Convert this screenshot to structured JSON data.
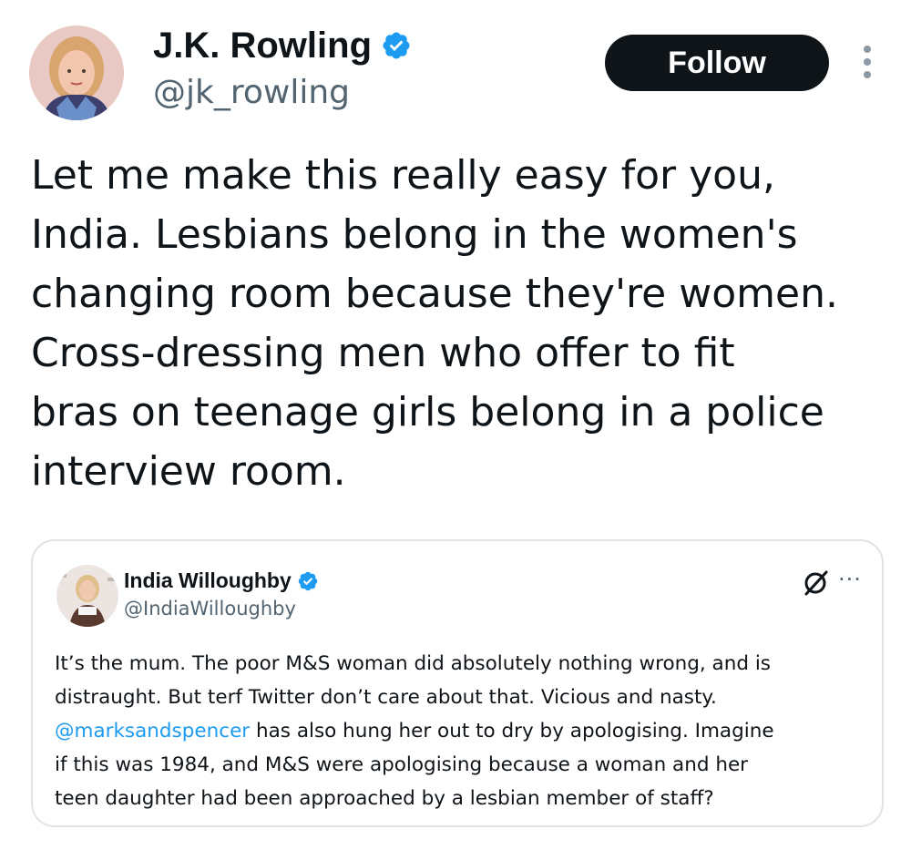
{
  "author": {
    "name": "J.K. Rowling",
    "handle": "@jk_rowling",
    "verified": true,
    "verified_color": "#1d9bf0"
  },
  "follow_button": {
    "label": "Follow"
  },
  "more_menu": {
    "icon": "more-vertical-icon"
  },
  "tweet": {
    "lines": [
      "Let me make this really easy for you,",
      "India. Lesbians belong in the women's",
      "changing room because they're women.",
      "Cross-dressing men who offer to fit",
      "bras on teenage girls belong in a police",
      "interview room."
    ]
  },
  "quoted_tweet": {
    "author_name": "India Willoughby",
    "author_handle": "@IndiaWilloughby",
    "verified": true,
    "lines": [
      "It’s the mum. The poor M&S woman did absolutely nothing wrong, and is",
      "distraught. But terf Twitter don’t care about that. Vicious and nasty.",
      " has also hung her out to dry by apologising. Imagine",
      "if this was 1984, and M&S were apologising because a woman and her",
      "teen daughter had been approached by a lesbian member of staff?"
    ],
    "mention": "@marksandspencer",
    "more_label": "···"
  },
  "colors": {
    "text": "#0f1419",
    "secondary": "#536471",
    "link": "#1d9bf0",
    "button_bg": "#0f1419",
    "border": "#dfe3e7"
  }
}
